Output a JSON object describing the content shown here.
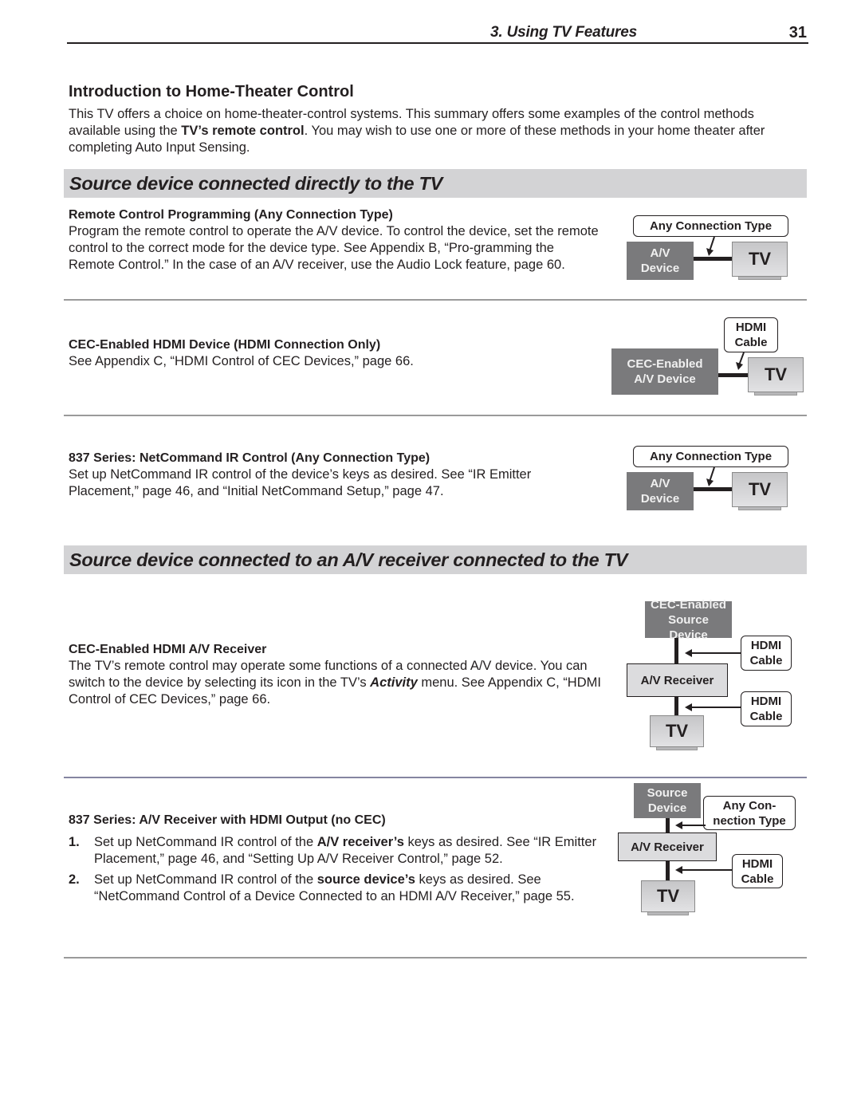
{
  "header": {
    "chapter": "3.  Using TV Features",
    "page_number": "31"
  },
  "intro": {
    "title": "Introduction to Home-Theater Control",
    "text_before": "This TV offers a choice on home-theater-control systems. This summary offers some examples of the control methods available using the ",
    "text_bold": "TV’s remote control",
    "text_after": ".  You may wish to use one or more of these methods in your home theater after completing Auto Input Sensing."
  },
  "sections": [
    {
      "title": "Source device connected directly to the TV",
      "items": [
        {
          "title": "Remote Control Programming (Any Connection Type)",
          "text": "Program the remote control to operate the A/V device.  To control the device, set the remote control to the correct mode for the device type.  See  Appendix B, “Pro-gramming the Remote Control.”  In the case of an A/V receiver, use the Audio Lock feature, page 60.",
          "diagram": {
            "label": "Any Connection Type",
            "device": "A/V Device",
            "tv": "TV"
          }
        },
        {
          "title": "CEC-Enabled HDMI Device (HDMI Connection Only)",
          "text": "See Appendix C, “HDMI Control of CEC Devices,” page 66.",
          "diagram": {
            "label": "HDMI Cable",
            "device": "CEC-Enabled A/V Device",
            "tv": "TV"
          }
        },
        {
          "title": "837 Series:  NetCommand IR Control (Any Connection Type)",
          "text": "Set up NetCommand IR control of the device’s keys as desired.  See “IR Emitter Placement,” page 46, and “Initial NetCommand Setup,” page 47.",
          "diagram": {
            "label": "Any Connection Type",
            "device": "A/V Device",
            "tv": "TV"
          }
        }
      ]
    },
    {
      "title": "Source device connected to an A/V receiver connected to the TV",
      "items": [
        {
          "title": "CEC-Enabled HDMI A/V Receiver",
          "text_before": "The TV’s remote control may operate some functions of a connected A/V device.  You can switch to the device by selecting its icon in the TV’s ",
          "text_bold_italic": "Activity",
          "text_after": " menu.  See Appendix C, “HDMI Control of CEC Devices,” page 66.",
          "diagram": {
            "source": "CEC-Enabled Source Device",
            "label_top": "HDMI Cable",
            "receiver": "A/V Receiver",
            "label_bottom": "HDMI Cable",
            "tv": "TV"
          }
        },
        {
          "title": "837 Series:  A/V Receiver with HDMI Output (no CEC)",
          "steps": [
            {
              "num": "1.",
              "before": "Set up NetCommand IR control of the ",
              "bold": "A/V receiver’s",
              "after": " keys as desired.  See “IR Emitter Placement,” page 46, and “Setting Up A/V Receiver Control,” page 52."
            },
            {
              "num": "2.",
              "before": "Set up NetCommand IR control of the ",
              "bold": "source device’s",
              "after": " keys as desired.  See “NetCommand Control of a Device Connected to an HDMI A/V Receiver,” page 55."
            }
          ],
          "diagram": {
            "source": "Source Device",
            "label_top": "Any Con-nection Type",
            "receiver": "A/V Receiver",
            "label_bottom": "HDMI Cable",
            "tv": "TV"
          }
        }
      ]
    }
  ]
}
